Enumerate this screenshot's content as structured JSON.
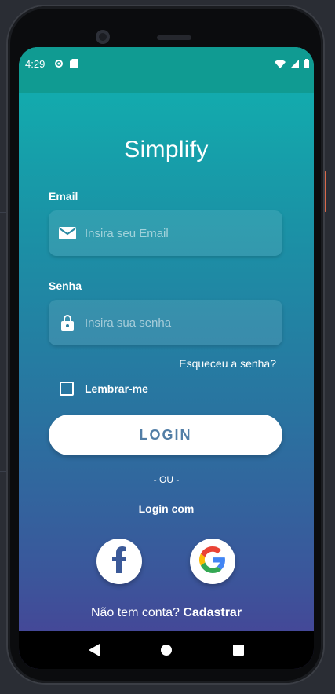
{
  "status": {
    "time": "4:29"
  },
  "app": {
    "title": "Simplify"
  },
  "form": {
    "email_label": "Email",
    "email_placeholder": "Insira seu Email",
    "password_label": "Senha",
    "password_placeholder": "Insira sua senha",
    "forgot": "Esqueceu a senha?",
    "remember": "Lembrar-me",
    "remember_checked": false,
    "login_button": "LOGIN"
  },
  "social": {
    "or": "- OU -",
    "login_with": "Login com",
    "providers": [
      "facebook-icon",
      "google-icon"
    ]
  },
  "signup": {
    "prompt": "Não tem conta?",
    "link": "Cadastrar"
  },
  "colors": {
    "gradient_top": "#10b3b0",
    "gradient_bottom": "#4a3f95",
    "statusbar": "#109b92",
    "button_text": "#527ea6"
  }
}
